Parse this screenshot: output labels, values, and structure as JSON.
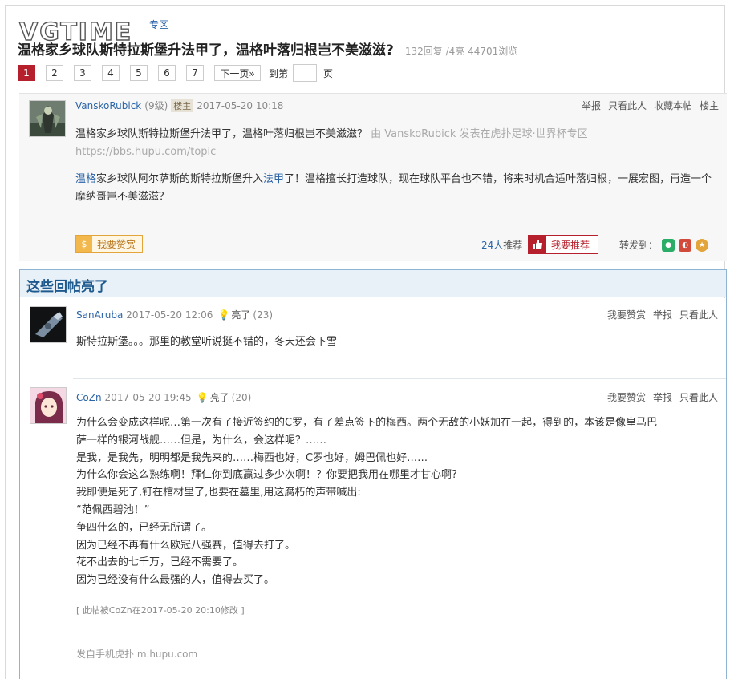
{
  "watermark": "VGTIME",
  "breadcrumb": "专区",
  "thread": {
    "title": "温格家乡球队斯特拉斯堡升法甲了，温格叶落归根岂不美滋滋?",
    "meta": "132回复 /4亮  44701浏览"
  },
  "pager": {
    "pages": [
      "1",
      "2",
      "3",
      "4",
      "5",
      "6",
      "7"
    ],
    "next": "下一页»",
    "goto_label": "到第",
    "goto_unit": "页"
  },
  "main_post": {
    "author": "VanskoRubick",
    "level": "(9级)",
    "role": "楼主",
    "time": "2017-05-20 10:18",
    "actions": [
      "举报",
      "只看此人",
      "收藏本帖",
      "楼主"
    ],
    "quote_text": "温格家乡球队斯特拉斯堡升法甲了，温格叶落归根岂不美滋滋？",
    "quote_source": "由 VanskoRubick 发表在虎扑足球·世界杯专区 https://bbs.hupu.com/topic",
    "body_link1": "温格",
    "body_part1": "家乡球队阿尔萨斯的斯特拉斯堡升入",
    "body_link2": "法甲",
    "body_part2": "了！温格擅长打造球队，现在球队平台也不错，将来时机合适叶落归根，一展宏图，再造一个摩纳哥岂不美滋滋？",
    "zan_label": "我要赞赏",
    "rec_count": "24人",
    "rec_suffix": "推荐",
    "rec_label": "我要推荐",
    "share_label": "转发到："
  },
  "highlight": {
    "title": "这些回帖亮了",
    "replies": [
      {
        "author": "SanAruba",
        "time": "2017-05-20 12:06",
        "light": "亮了",
        "light_count": "(23)",
        "actions": [
          "我要赞赏",
          "举报",
          "只看此人"
        ],
        "lines": [
          "斯特拉斯堡。。。那里的教堂听说挺不错的，冬天还会下雪"
        ]
      },
      {
        "author": "CoZn",
        "time": "2017-05-20 19:45",
        "light": "亮了",
        "light_count": "(20)",
        "actions": [
          "我要赞赏",
          "举报",
          "只看此人"
        ],
        "lines": [
          "为什么会变成这样呢…第一次有了接近签约的C罗，有了差点签下的梅西。两个无敌的小妖加在一起，得到的，本该是像皇马巴",
          "萨一样的银河战舰……但是，为什么，会这样呢？……",
          "是我，是我先，明明都是我先来的……梅西也好，C罗也好，姆巴佩也好……",
          "为什么你会这么熟练啊！拜仁你到底赢过多少次啊！？你要把我用在哪里才甘心啊?",
          "我即使是死了,钉在棺材里了,也要在墓里,用这腐朽的声带喊出:",
          "“范佩西碧池！”",
          "争四什么的，已经无所谓了。",
          "因为已经不再有什么欧冠八强赛，值得去打了。",
          "花不出去的七千万，已经不需要了。",
          "因为已经没有什么最强的人，值得去买了。"
        ],
        "edit_note": "[ 此帖被CoZn在2017-05-20 20:10修改 ]",
        "source": "发自手机虎扑 m.hupu.com"
      }
    ]
  }
}
